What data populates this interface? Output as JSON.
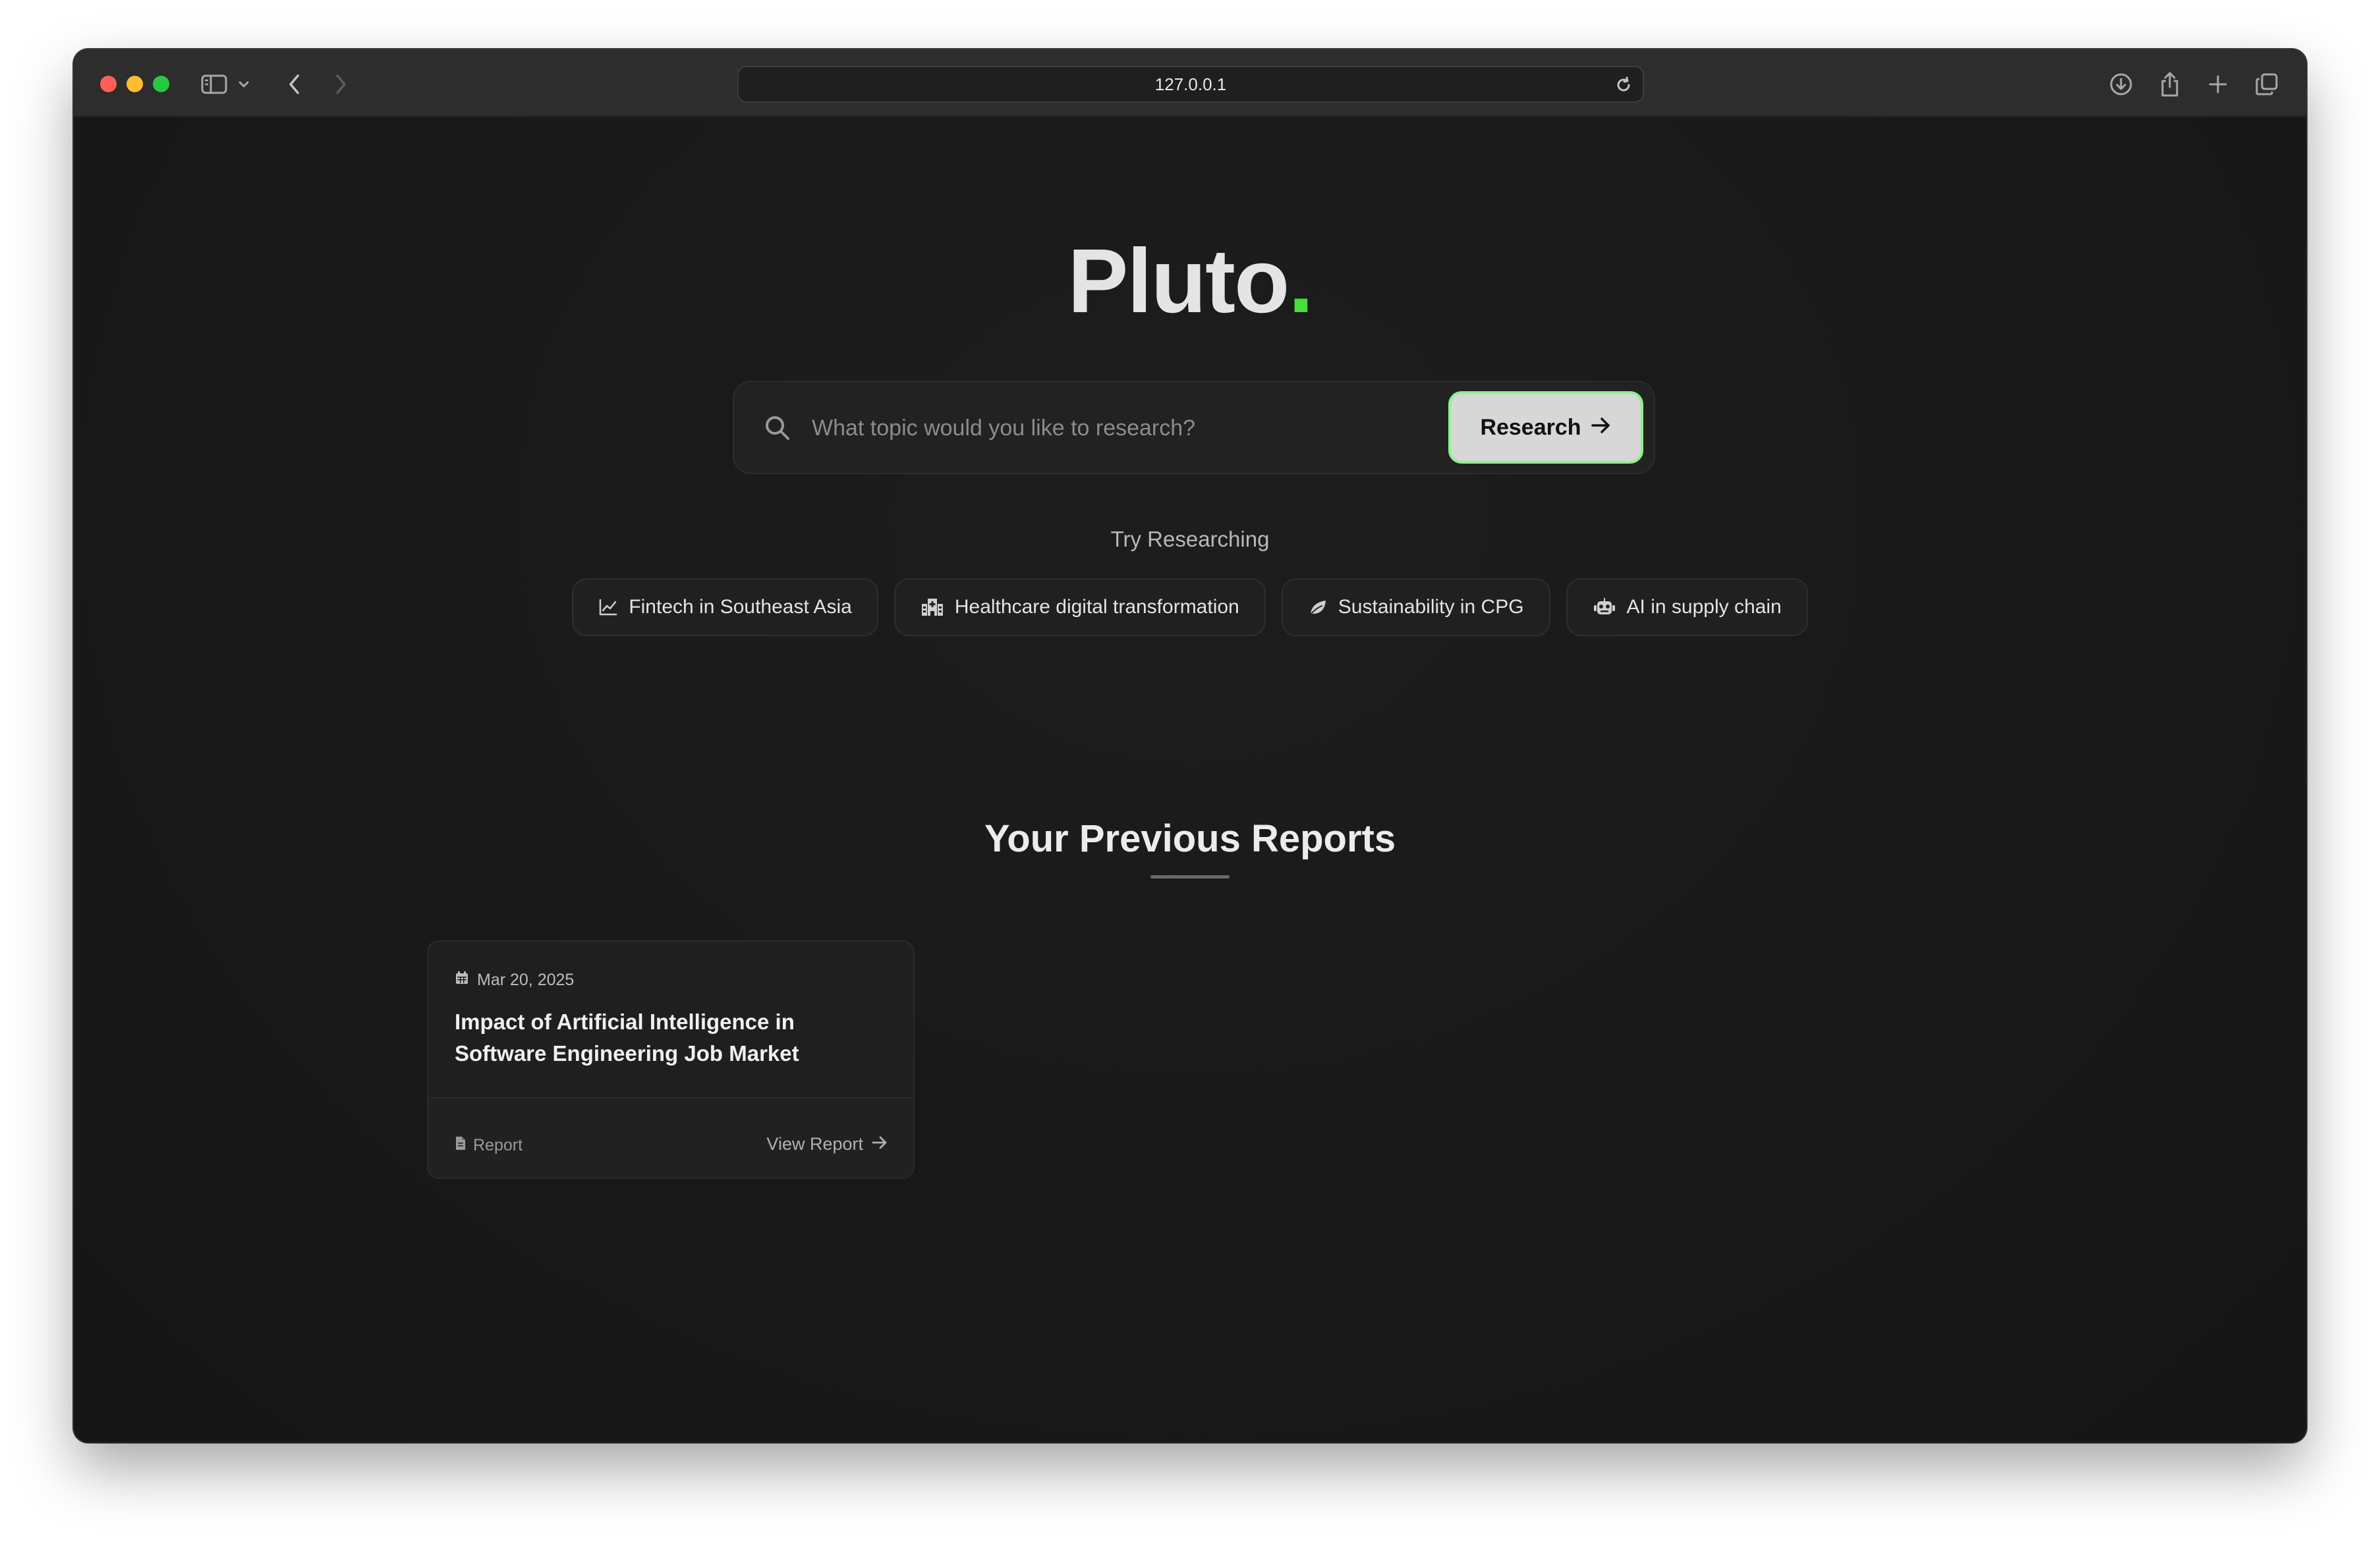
{
  "browser": {
    "url": "127.0.0.1"
  },
  "logo": {
    "text": "Pluto",
    "dot": "."
  },
  "search": {
    "placeholder": "What topic would you like to research?",
    "value": "",
    "button_label": "Research"
  },
  "suggestions": {
    "label": "Try Researching",
    "items": [
      {
        "label": "Fintech in Southeast Asia",
        "icon": "chart-line-icon"
      },
      {
        "label": "Healthcare digital transformation",
        "icon": "hospital-icon"
      },
      {
        "label": "Sustainability in CPG",
        "icon": "leaf-icon"
      },
      {
        "label": "AI in supply chain",
        "icon": "robot-icon"
      }
    ]
  },
  "reports": {
    "title": "Your Previous Reports",
    "items": [
      {
        "date": "Mar 20, 2025",
        "title": "Impact of Artificial Intelligence in Software Engineering Job Market",
        "type": "Report",
        "action": "View Report"
      }
    ]
  },
  "colors": {
    "accent": "#4ade3c",
    "background": "#181818",
    "button_bg": "#d7d7d7",
    "button_border": "#8ef08a"
  }
}
